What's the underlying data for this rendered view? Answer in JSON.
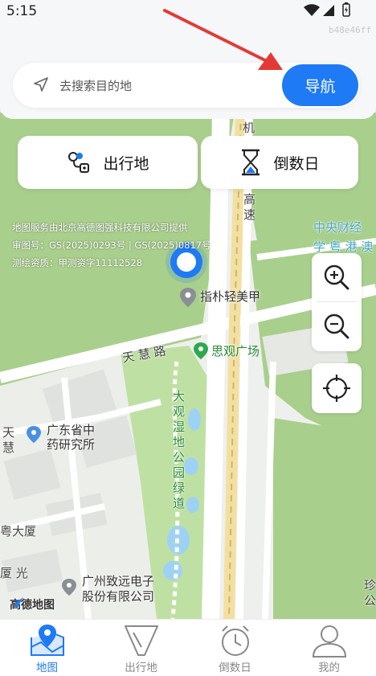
{
  "status_bar": {
    "time": "5:15",
    "device_id": "b48e46ff"
  },
  "search": {
    "placeholder": "去搜索目的地",
    "nav_label": "导航"
  },
  "quick_actions": [
    {
      "label": "出行地",
      "icon": "route-icon"
    },
    {
      "label": "倒数日",
      "icon": "hourglass-icon"
    }
  ],
  "map": {
    "copyright_lines": [
      "地图服务由北京高德图强科技有限公司提供",
      "审图号：GS(2025)0293号 | GS(2025)0817号",
      "测绘资质：甲测资字11112528"
    ],
    "road_labels": {
      "tianhui": "天 慧 路",
      "gaosu": "高速",
      "ji": "机",
      "park_trail": "大观湿地公园绿道",
      "zhongyang": "中央财经",
      "xue": "学 粤 港 澳",
      "tian_vert": "天慧",
      "yue": "粤大厦",
      "xiaguang": "厦 光",
      "zhen": "珍公"
    },
    "pois": {
      "zhipu": "指朴轻美甲",
      "siguan": "思观广场",
      "guangdong_line1": "广东省中",
      "guangdong_line2": "药研究所",
      "zhiyuan_line1": "广州致远电子",
      "zhiyuan_line2": "股份有限公司"
    },
    "brand": "高德地图"
  },
  "tabs": [
    {
      "label": "地图",
      "active": true
    },
    {
      "label": "出行地",
      "active": false
    },
    {
      "label": "倒数日",
      "active": false
    },
    {
      "label": "我的",
      "active": false
    }
  ],
  "colors": {
    "accent": "#1e7af5",
    "park": "#cfe8b9",
    "road": "#ffffff",
    "highway": "#e9d79d"
  }
}
